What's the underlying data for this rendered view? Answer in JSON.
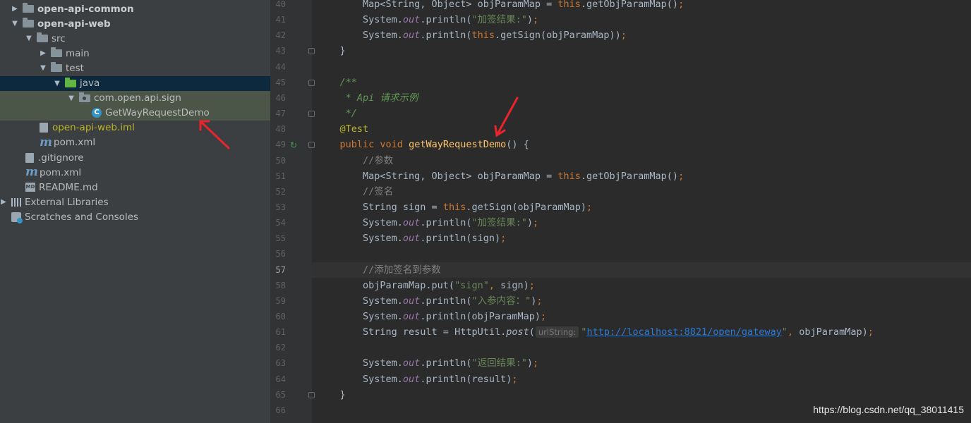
{
  "tree": {
    "items": [
      {
        "label": "open-api-common",
        "indent": 16,
        "arrow": "▶",
        "icon": "module-folder-icon",
        "bold": true
      },
      {
        "label": "open-api-web",
        "indent": 16,
        "arrow": "▼",
        "icon": "module-folder-icon",
        "bold": true
      },
      {
        "label": "src",
        "indent": 36,
        "arrow": "▼",
        "icon": "folder-icon"
      },
      {
        "label": "main",
        "indent": 56,
        "arrow": "▶",
        "icon": "folder-icon"
      },
      {
        "label": "test",
        "indent": 56,
        "arrow": "▼",
        "icon": "folder-icon"
      },
      {
        "label": "java",
        "indent": 76,
        "arrow": "▼",
        "icon": "test-source-folder-icon",
        "state": "selected"
      },
      {
        "label": "com.open.api.sign",
        "indent": 96,
        "arrow": "▼",
        "icon": "package-icon",
        "state": "highlight"
      },
      {
        "label": "GetWayRequestDemo",
        "indent": 130,
        "arrow": "",
        "icon": "java-class-icon",
        "state": "highlight"
      },
      {
        "label": "open-api-web.iml",
        "indent": 56,
        "arrow": "",
        "icon": "iml-file-icon",
        "style": "iml"
      },
      {
        "label": "pom.xml",
        "indent": 56,
        "arrow": "",
        "icon": "maven-icon"
      },
      {
        "label": ".gitignore",
        "indent": 36,
        "arrow": "",
        "icon": "gitignore-icon"
      },
      {
        "label": "pom.xml",
        "indent": 36,
        "arrow": "",
        "icon": "maven-icon"
      },
      {
        "label": "README.md",
        "indent": 36,
        "arrow": "",
        "icon": "markdown-icon"
      },
      {
        "label": "External Libraries",
        "indent": 0,
        "arrow": "▶",
        "icon": "libraries-icon"
      },
      {
        "label": "Scratches and Consoles",
        "indent": 16,
        "arrow": "",
        "icon": "scratches-icon"
      }
    ]
  },
  "editor": {
    "current_line": "57",
    "lines": [
      {
        "n": "40",
        "html": "        Map&lt;String, Object&gt; objParamMap = <span class=\"kw\">this</span>.getObjParamMap()<span class=\"kw\">;</span>"
      },
      {
        "n": "41",
        "html": "        System.<span class=\"st\">out</span>.println(<span class=\"str\">\"加签结果:\"</span>)<span class=\"kw\">;</span>"
      },
      {
        "n": "42",
        "html": "        System.<span class=\"st\">out</span>.println(<span class=\"kw\">this</span>.getSign(objParamMap))<span class=\"kw\">;</span>"
      },
      {
        "n": "43",
        "html": "    }"
      },
      {
        "n": "44",
        "html": ""
      },
      {
        "n": "45",
        "html": "    <span class=\"doc\">/**</span>"
      },
      {
        "n": "46",
        "html": "    <span class=\"doc\"> * Api 请求示例</span>"
      },
      {
        "n": "47",
        "html": "    <span class=\"doc\"> */</span>"
      },
      {
        "n": "48",
        "html": "    <span class=\"ann\">@Test</span>"
      },
      {
        "n": "49",
        "html": "    <span class=\"kw\">public void</span> <span class=\"fn\">getWayRequestDemo</span>() {"
      },
      {
        "n": "50",
        "html": "        <span class=\"cmt\">//参数</span>"
      },
      {
        "n": "51",
        "html": "        Map&lt;String, Object&gt; objParamMap = <span class=\"kw\">this</span>.getObjParamMap()<span class=\"kw\">;</span>"
      },
      {
        "n": "52",
        "html": "        <span class=\"cmt\">//签名</span>"
      },
      {
        "n": "53",
        "html": "        String sign = <span class=\"kw\">this</span>.getSign(objParamMap)<span class=\"kw\">;</span>"
      },
      {
        "n": "54",
        "html": "        System.<span class=\"st\">out</span>.println(<span class=\"str\">\"加签结果:\"</span>)<span class=\"kw\">;</span>"
      },
      {
        "n": "55",
        "html": "        System.<span class=\"st\">out</span>.println(sign)<span class=\"kw\">;</span>"
      },
      {
        "n": "56",
        "html": ""
      },
      {
        "n": "57",
        "html": "        <span class=\"cmt\">//添加签名到参数</span>"
      },
      {
        "n": "58",
        "html": "        objParamMap.put(<span class=\"str\">\"sign\"</span><span class=\"kw\">,</span> sign)<span class=\"kw\">;</span>"
      },
      {
        "n": "59",
        "html": "        System.<span class=\"st\">out</span>.println(<span class=\"str\">\"入参内容：\"</span>)<span class=\"kw\">;</span>"
      },
      {
        "n": "60",
        "html": "        System.<span class=\"st\">out</span>.println(objParamMap)<span class=\"kw\">;</span>"
      },
      {
        "n": "61",
        "html": "        String result = HttpUtil.<span class=\"sm\">post</span>(<span class=\"hint\">urlString:</span><span class=\"str\">\"<span class=\"url\">http://localhost:8821/open/gateway</span>\"</span><span class=\"kw\">,</span> objParamMap)<span class=\"kw\">;</span>"
      },
      {
        "n": "62",
        "html": ""
      },
      {
        "n": "63",
        "html": "        System.<span class=\"st\">out</span>.println(<span class=\"str\">\"返回结果:\"</span>)<span class=\"kw\">;</span>"
      },
      {
        "n": "64",
        "html": "        System.<span class=\"st\">out</span>.println(result)<span class=\"kw\">;</span>"
      },
      {
        "n": "65",
        "html": "    }"
      },
      {
        "n": "66",
        "html": ""
      }
    ]
  },
  "watermark": "https://blog.csdn.net/qq_38011415",
  "colors": {
    "annotation_arrow": "#e8242c",
    "selection": "#0d293e",
    "highlight": "#4b5648"
  }
}
